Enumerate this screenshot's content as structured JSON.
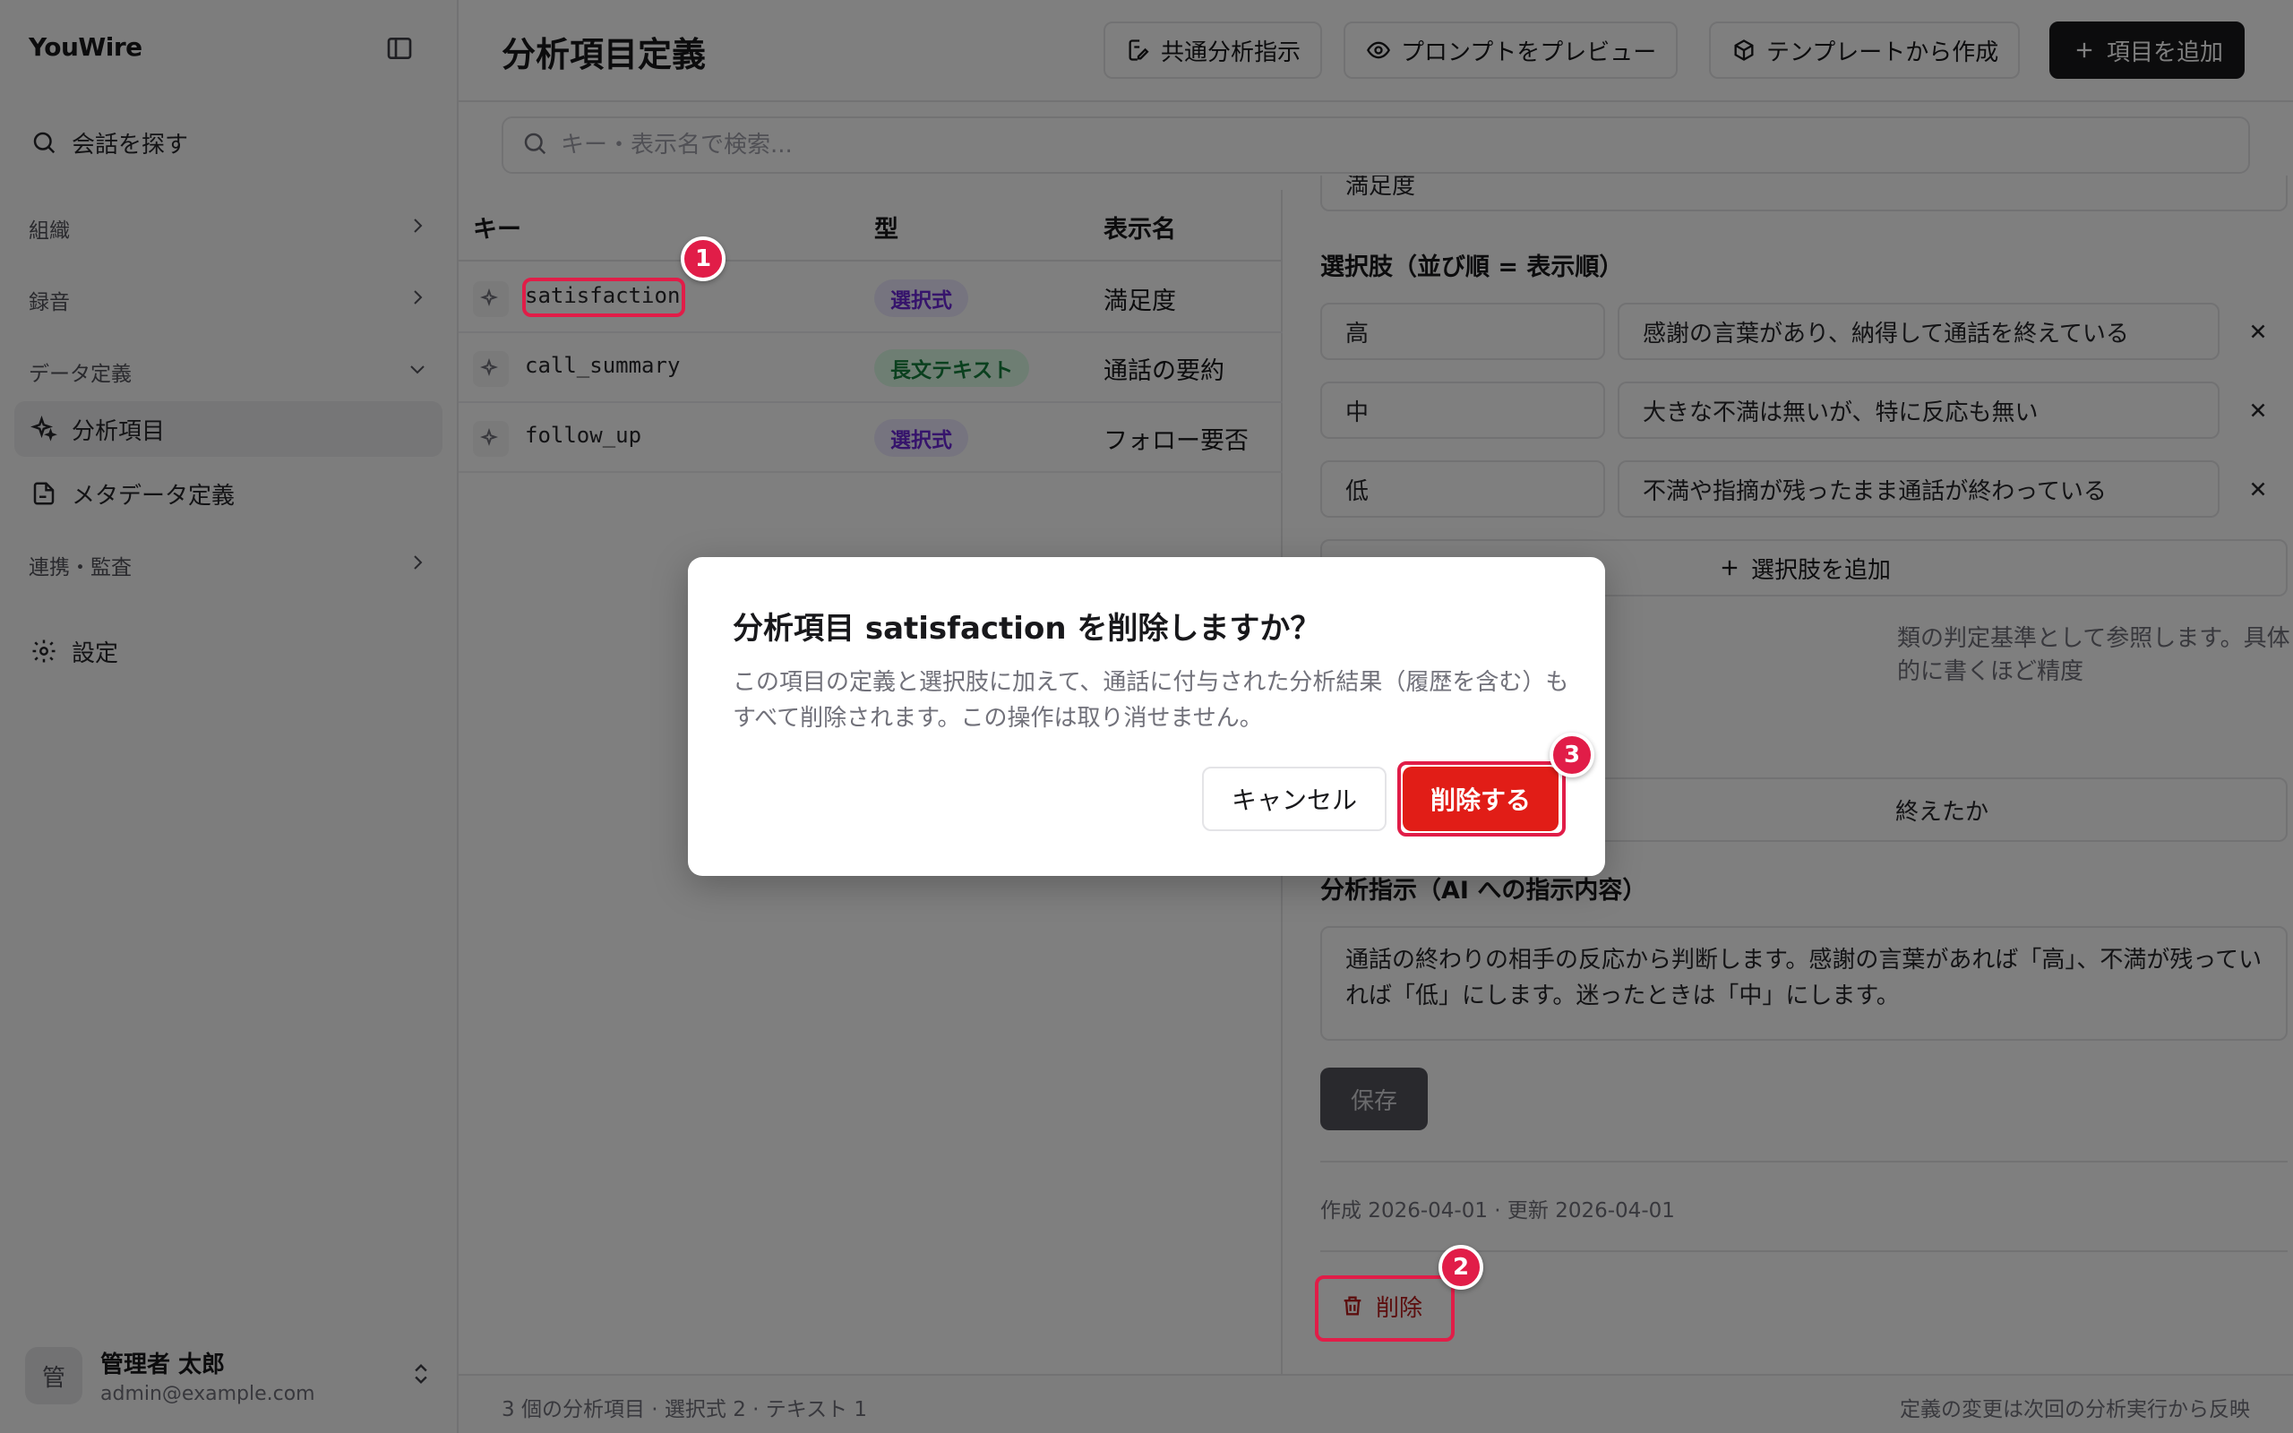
{
  "app": {
    "brand": "YouWire"
  },
  "sidebar": {
    "search_label": "会話を探す",
    "groups": {
      "org": "組織",
      "recording": "録音",
      "data_def": "データ定義",
      "integration": "連携・監査"
    },
    "items": {
      "analysis_items": "分析項目",
      "metadata": "メタデータ定義",
      "settings": "設定"
    },
    "user": {
      "avatar_initial": "管",
      "name": "管理者 太郎",
      "email": "admin@example.com"
    }
  },
  "header": {
    "title": "分析項目定義",
    "buttons": {
      "common_instructions": "共通分析指示",
      "preview_prompt": "プロンプトをプレビュー",
      "from_template": "テンプレートから作成",
      "add_item": "項目を追加"
    }
  },
  "search": {
    "placeholder": "キー・表示名で検索..."
  },
  "table": {
    "columns": {
      "key": "キー",
      "type": "型",
      "display": "表示名"
    },
    "rows": [
      {
        "key": "satisfaction",
        "type": "選択式",
        "display": "満足度"
      },
      {
        "key": "call_summary",
        "type": "長文テキスト",
        "display": "通話の要約"
      },
      {
        "key": "follow_up",
        "type": "選択式",
        "display": "フォロー要否"
      }
    ]
  },
  "detail": {
    "display_name_value": "満足度",
    "choices_label": "選択肢（並び順 = 表示順）",
    "choices": [
      {
        "label": "高",
        "desc": "感謝の言葉があり、納得して通話を終えている"
      },
      {
        "label": "中",
        "desc": "大きな不満は無いが、特に反応も無い"
      },
      {
        "label": "低",
        "desc": "不満や指摘が残ったまま通話が終わっている"
      }
    ],
    "add_choice": "選択肢を追加",
    "hint_visible": "類の判定基準として参照します。具体的に書くほど精度",
    "question_visible": "終えたか",
    "instruction_label": "分析指示（AI への指示内容）",
    "instruction_text": "通話の終わりの相手の反応から判断します。感謝の言葉があれば「高」、不満が残っていれば「低」にします。迷ったときは「中」にします。",
    "save": "保存",
    "meta": "作成 2026-04-01 · 更新 2026-04-01",
    "delete": "削除"
  },
  "footer": {
    "summary": "3 個の分析項目 · 選択式 2 · テキスト 1",
    "note": "定義の変更は次回の分析実行から反映"
  },
  "dialog": {
    "title": "分析項目 satisfaction を削除しますか？",
    "description": "この項目の定義と選択肢に加えて、通話に付与された分析結果（履歴を含む）もすべて削除されます。この操作は取り消せません。",
    "cancel": "キャンセル",
    "confirm": "削除する"
  },
  "annotations": {
    "m1": "1",
    "m2": "2",
    "m3": "3"
  },
  "colors": {
    "accent": "#e11d48",
    "danger": "#e11d17",
    "primary": "#18181b"
  }
}
